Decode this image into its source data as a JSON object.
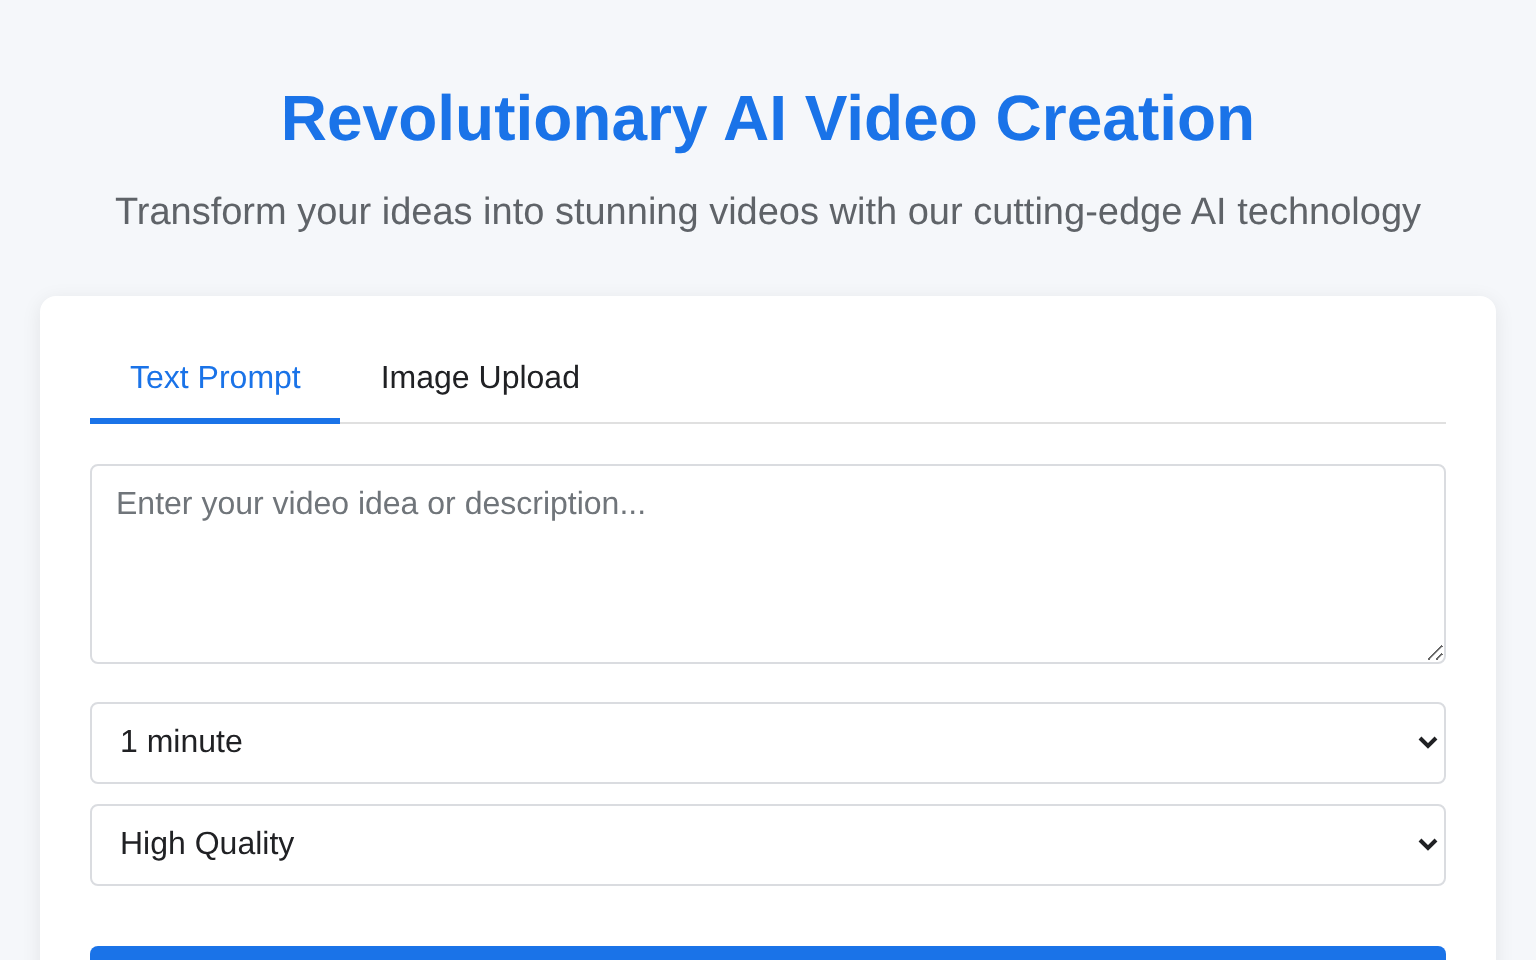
{
  "header": {
    "title": "Revolutionary AI Video Creation",
    "subtitle": "Transform your ideas into stunning videos with our cutting-edge AI technology"
  },
  "tabs": [
    {
      "label": "Text Prompt",
      "selected": true
    },
    {
      "label": "Image Upload",
      "selected": false
    }
  ],
  "prompt": {
    "placeholder": "Enter your video idea or description..."
  },
  "selects": [
    {
      "value": "1 minute"
    },
    {
      "value": "High Quality"
    }
  ]
}
